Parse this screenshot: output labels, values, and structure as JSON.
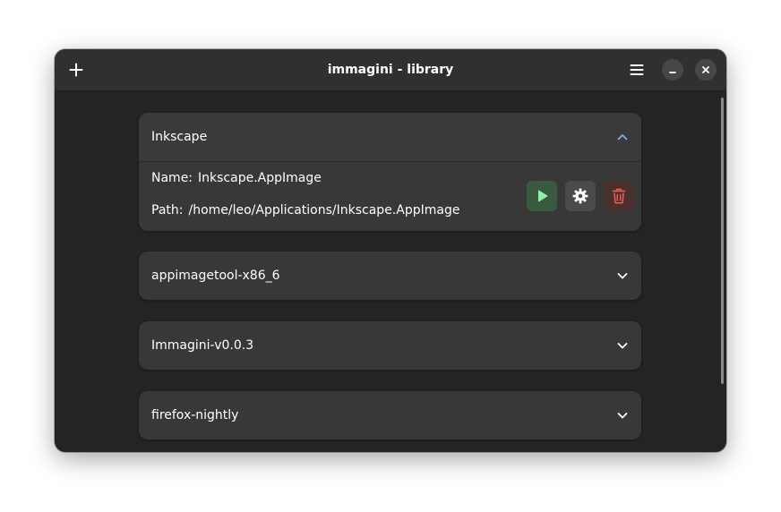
{
  "window": {
    "title": "immagini - library"
  },
  "icons": {
    "add": "plus-icon",
    "menu": "hamburger-icon",
    "minimize": "minimize-icon",
    "close": "close-icon",
    "expand": "chevron-down-icon",
    "collapse": "chevron-up-icon",
    "run": "play-icon",
    "settings": "gear-icon",
    "delete": "trash-icon"
  },
  "colors": {
    "accent": "#78aeed",
    "run": "#8ff0a4",
    "delete": "#f66151"
  },
  "library": {
    "items": [
      {
        "name": "Inkscape",
        "expanded": true,
        "name_label": "Name:",
        "name_value": "Inkscape.AppImage",
        "path_label": "Path:",
        "path_value": "/home/leo/Applications/Inkscape.AppImage"
      },
      {
        "name": "appimagetool-x86_6",
        "expanded": false
      },
      {
        "name": "Immagini-v0.0.3",
        "expanded": false
      },
      {
        "name": "firefox-nightly",
        "expanded": false
      }
    ]
  }
}
